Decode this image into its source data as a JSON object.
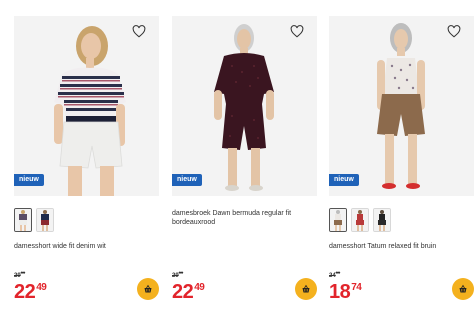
{
  "products": [
    {
      "badge": "nieuw",
      "name": "damesshort wide fit denim wit",
      "old_price_main": "29",
      "old_price_cents": "99",
      "price_main": "22",
      "price_cents": "49",
      "favorite_icon": "heart-outline-icon",
      "cart_icon": "shopping-basket-icon",
      "swatch_count": 2,
      "colors": {
        "top": "#2a2f4a",
        "bottom": "#f0f0ee"
      }
    },
    {
      "badge": "nieuw",
      "name": "damesbroek Dawn bermuda regular fit bordeauxrood",
      "old_price_main": "29",
      "old_price_cents": "99",
      "price_main": "22",
      "price_cents": "49",
      "favorite_icon": "heart-outline-icon",
      "cart_icon": "shopping-basket-icon",
      "swatch_count": 0,
      "colors": {
        "top": "#3a1520",
        "bottom": "#3a1520"
      }
    },
    {
      "badge": "nieuw",
      "name": "damesshort Tatum relaxed fit bruin",
      "old_price_main": "24",
      "old_price_cents": "99",
      "price_main": "18",
      "price_cents": "74",
      "favorite_icon": "heart-outline-icon",
      "cart_icon": "shopping-basket-icon",
      "swatch_count": 3,
      "colors": {
        "top": "#ece8e4",
        "bottom": "#8c6a4c"
      }
    }
  ],
  "theme": {
    "price_color": "#e2242b",
    "badge_color": "#1f62b8",
    "cart_button_color": "#f4b11e"
  }
}
